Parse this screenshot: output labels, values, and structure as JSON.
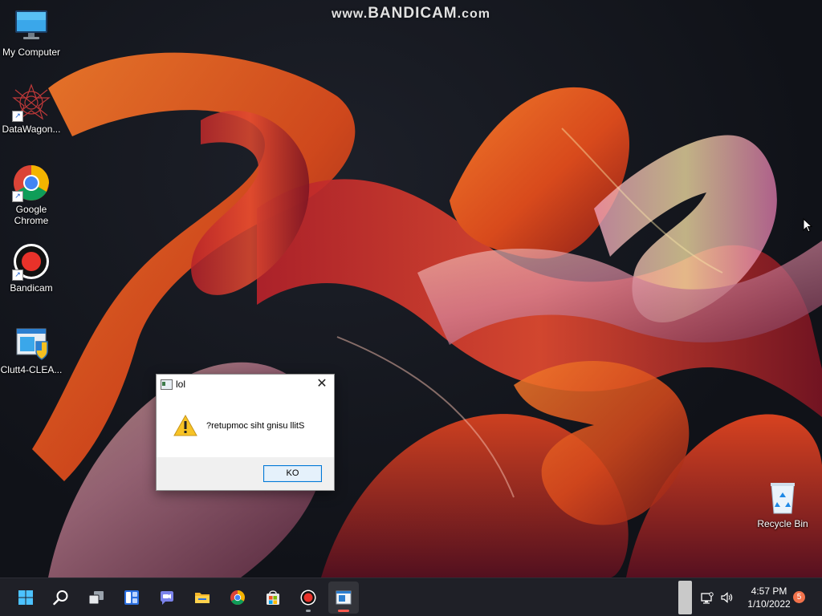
{
  "watermark": {
    "prefix": "www.",
    "brand": "BANDICAM",
    "suffix": ".com"
  },
  "desktop": {
    "icons": [
      {
        "label": "My Computer",
        "icon": "monitor-icon"
      },
      {
        "label": "DataWagon...",
        "icon": "datawagon-icon",
        "shortcut": true
      },
      {
        "label": "Google Chrome",
        "icon": "chrome-icon",
        "shortcut": true
      },
      {
        "label": "Bandicam",
        "icon": "bandicam-icon",
        "shortcut": true
      },
      {
        "label": "Clutt4-CLEA...",
        "icon": "installer-icon"
      },
      {
        "label": "Recycle Bin",
        "icon": "recycle-bin-icon"
      }
    ]
  },
  "dialog": {
    "title": "lol",
    "close_glyph": "✕",
    "message": "?retupmoc siht gnisu llitS",
    "ok_label": "KO",
    "icon": "warning-icon"
  },
  "taskbar": {
    "items": [
      {
        "name": "start",
        "icon": "windows-start-icon"
      },
      {
        "name": "search",
        "icon": "search-icon"
      },
      {
        "name": "task-view",
        "icon": "task-view-icon"
      },
      {
        "name": "widgets",
        "icon": "widgets-icon"
      },
      {
        "name": "teams-chat",
        "icon": "chat-icon"
      },
      {
        "name": "file-explorer",
        "icon": "folder-icon"
      },
      {
        "name": "chrome",
        "icon": "chrome-icon"
      },
      {
        "name": "store",
        "icon": "store-icon"
      },
      {
        "name": "bandicam",
        "icon": "record-icon",
        "running": true
      },
      {
        "name": "dialog-app",
        "icon": "app-window-icon",
        "running": true,
        "active": true
      }
    ],
    "tray": {
      "network_icon": "network-icon",
      "volume_icon": "volume-icon"
    },
    "clock": {
      "time": "4:57 PM",
      "date": "1/10/2022"
    },
    "notification_count": "5"
  },
  "colors": {
    "accent": "#0078d7",
    "taskbar": "#1f2027",
    "badge": "#f2724b",
    "record_red": "#e8322a"
  }
}
